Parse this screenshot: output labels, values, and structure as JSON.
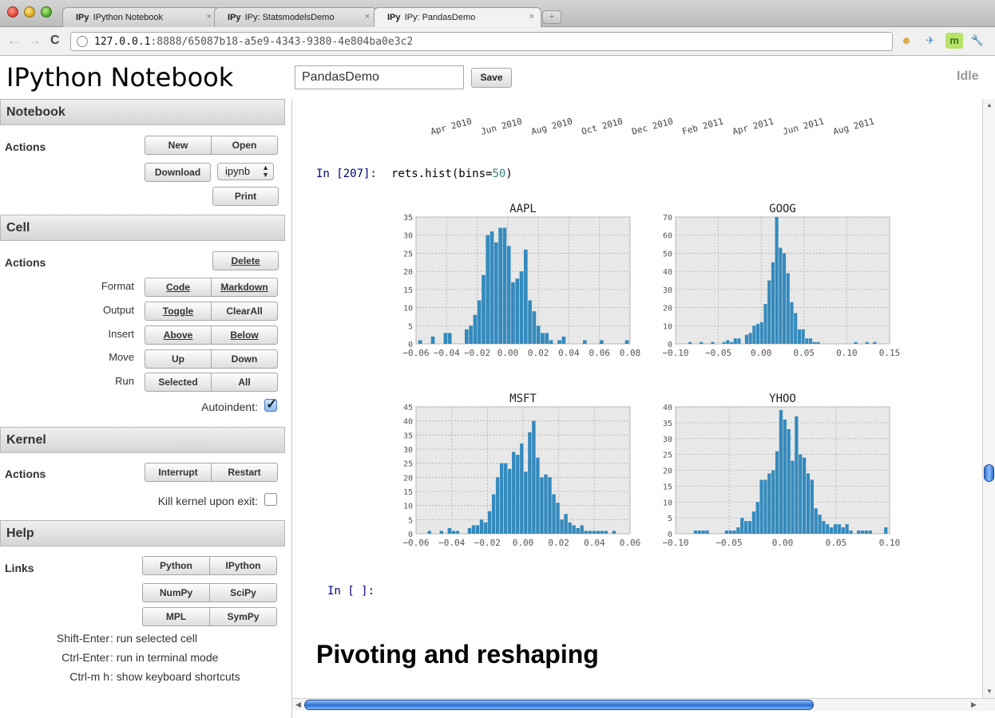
{
  "browser": {
    "tabs": [
      {
        "prefix": "IPy",
        "label": "IPython Notebook",
        "close": "×"
      },
      {
        "prefix": "IPy",
        "label": "IPy: StatsmodelsDemo",
        "close": "×"
      },
      {
        "prefix": "IPy",
        "label": "IPy: PandasDemo",
        "close": "×"
      }
    ],
    "new_tab": "+",
    "nav": {
      "back": "←",
      "forward": "→",
      "reload": "C"
    },
    "url_host": "127.0.0.1",
    "url_rest": ":8888/65087b18-a5e9-4343-9380-4e804ba0e3c2",
    "star": "☆",
    "extensions": [
      {
        "icon": "cookie-extension-icon",
        "glyph": "☻",
        "color": "#d8a040"
      },
      {
        "icon": "bird-extension-icon",
        "glyph": "✈",
        "color": "#4a90d0"
      },
      {
        "icon": "m-extension-icon",
        "glyph": "m",
        "color": "#3a7a20"
      },
      {
        "icon": "wrench-icon",
        "glyph": "🔧",
        "color": "#555555"
      }
    ]
  },
  "header": {
    "title": "IPython Notebook",
    "notebook_name": "PandasDemo",
    "save_label": "Save",
    "status": "Idle"
  },
  "sidebar": {
    "notebook": {
      "title": "Notebook",
      "actions_label": "Actions",
      "new": "New",
      "open": "Open",
      "download": "Download",
      "format_value": "ipynb",
      "print": "Print"
    },
    "cell": {
      "title": "Cell",
      "actions_label": "Actions",
      "delete": "Delete",
      "format_label": "Format",
      "code": "Code",
      "markdown": "Markdown",
      "output_label": "Output",
      "toggle": "Toggle",
      "clearall": "ClearAll",
      "insert_label": "Insert",
      "above": "Above",
      "below": "Below",
      "move_label": "Move",
      "up": "Up",
      "down": "Down",
      "run_label": "Run",
      "selected": "Selected",
      "all": "All",
      "autoindent_label": "Autoindent:",
      "autoindent_checked": true
    },
    "kernel": {
      "title": "Kernel",
      "actions_label": "Actions",
      "interrupt": "Interrupt",
      "restart": "Restart",
      "kill_label": "Kill kernel upon exit:",
      "kill_checked": false
    },
    "help": {
      "title": "Help",
      "links_label": "Links",
      "python": "Python",
      "ipython": "IPython",
      "numpy": "NumPy",
      "scipy": "SciPy",
      "mpl": "MPL",
      "sympy": "SymPy",
      "shortcuts": [
        {
          "keys": "Shift-Enter",
          "desc": "run selected cell"
        },
        {
          "keys": "Ctrl-Enter",
          "desc": "run in terminal mode"
        },
        {
          "keys": "Ctrl-m h",
          "desc": "show keyboard shortcuts"
        }
      ]
    }
  },
  "main": {
    "date_ticks": [
      "Apr 2010",
      "Jun 2010",
      "Aug 2010",
      "Oct 2010",
      "Dec 2010",
      "Feb 2011",
      "Apr 2011",
      "Jun 2011",
      "Aug 2011"
    ],
    "cell_in_prompt": "In [207]:",
    "cell_code_prefix": "rets.hist(bins=",
    "cell_code_number": "50",
    "cell_code_suffix": ")",
    "empty_prompt": "In [ ]:",
    "heading": "Pivoting and reshaping"
  },
  "chart_data": [
    {
      "type": "bar",
      "title": "AAPL",
      "xlim": [
        -0.06,
        0.08
      ],
      "ylim": [
        0,
        35
      ],
      "xticks": [
        -0.06,
        -0.04,
        -0.02,
        0.0,
        0.02,
        0.04,
        0.06,
        0.08
      ],
      "xtick_labels": [
        "−0.06",
        "−0.04",
        "−0.02",
        "0.00",
        "0.02",
        "0.04",
        "0.06",
        "0.08"
      ],
      "yticks": [
        0,
        5,
        10,
        15,
        20,
        25,
        30,
        35
      ],
      "bin_start": -0.0585,
      "bin_width": 0.00276,
      "counts": [
        1,
        0,
        0,
        2,
        0,
        0,
        3,
        3,
        0,
        0,
        0,
        4,
        5,
        8,
        12,
        19,
        30,
        31,
        28,
        32,
        32,
        27,
        17,
        18,
        20,
        26,
        12,
        9,
        5,
        3,
        3,
        1,
        0,
        1,
        2,
        0,
        0,
        0,
        0,
        1,
        0,
        0,
        0,
        1,
        0,
        0,
        0,
        0,
        0,
        1
      ],
      "bar_color": "#348ABD"
    },
    {
      "type": "bar",
      "title": "GOOG",
      "xlim": [
        -0.1,
        0.15
      ],
      "ylim": [
        0,
        70
      ],
      "xticks": [
        -0.1,
        -0.05,
        0.0,
        0.05,
        0.1,
        0.15
      ],
      "xtick_labels": [
        "−0.10",
        "−0.05",
        "0.00",
        "0.05",
        "0.10",
        "0.15"
      ],
      "yticks": [
        0,
        10,
        20,
        30,
        40,
        50,
        60,
        70
      ],
      "bin_start": -0.085,
      "bin_width": 0.0044,
      "counts": [
        1,
        0,
        0,
        1,
        0,
        0,
        1,
        0,
        0,
        1,
        2,
        1,
        3,
        3,
        0,
        5,
        6,
        10,
        11,
        12,
        22,
        35,
        45,
        70,
        53,
        50,
        39,
        23,
        17,
        8,
        8,
        3,
        3,
        1,
        1,
        0,
        0,
        0,
        0,
        0,
        0,
        0,
        0,
        0,
        1,
        0,
        0,
        1,
        0,
        1
      ],
      "bar_color": "#348ABD"
    },
    {
      "type": "bar",
      "title": "MSFT",
      "xlim": [
        -0.06,
        0.06
      ],
      "ylim": [
        0,
        45
      ],
      "xticks": [
        -0.06,
        -0.04,
        -0.02,
        0.0,
        0.02,
        0.04,
        0.06
      ],
      "xtick_labels": [
        "−0.06",
        "−0.04",
        "−0.02",
        "0.00",
        "0.02",
        "0.04",
        "0.06"
      ],
      "yticks": [
        0,
        5,
        10,
        15,
        20,
        25,
        30,
        35,
        40,
        45
      ],
      "bin_start": -0.0535,
      "bin_width": 0.00225,
      "counts": [
        1,
        0,
        0,
        1,
        0,
        2,
        1,
        1,
        0,
        0,
        2,
        3,
        3,
        5,
        4,
        8,
        14,
        20,
        25,
        25,
        23,
        29,
        28,
        32,
        22,
        36,
        40,
        27,
        20,
        21,
        20,
        14,
        11,
        5,
        7,
        4,
        3,
        2,
        3,
        1,
        1,
        1,
        1,
        1,
        1,
        0,
        1,
        0,
        0,
        0
      ],
      "bar_color": "#348ABD"
    },
    {
      "type": "bar",
      "title": "YHOO",
      "xlim": [
        -0.1,
        0.1
      ],
      "ylim": [
        0,
        40
      ],
      "xticks": [
        -0.1,
        -0.05,
        0.0,
        0.05,
        0.1
      ],
      "xtick_labels": [
        "−0.10",
        "−0.05",
        "0.00",
        "0.05",
        "0.10"
      ],
      "yticks": [
        0,
        5,
        10,
        15,
        20,
        25,
        30,
        35,
        40
      ],
      "bin_start": -0.083,
      "bin_width": 0.00363,
      "counts": [
        1,
        1,
        1,
        1,
        0,
        0,
        0,
        0,
        1,
        1,
        1,
        2,
        5,
        4,
        4,
        7,
        10,
        17,
        17,
        19,
        20,
        26,
        39,
        36,
        33,
        23,
        37,
        25,
        24,
        19,
        17,
        8,
        6,
        4,
        3,
        2,
        3,
        3,
        2,
        3,
        1,
        0,
        1,
        1,
        1,
        1,
        0,
        0,
        0,
        2
      ],
      "bar_color": "#348ABD"
    }
  ]
}
